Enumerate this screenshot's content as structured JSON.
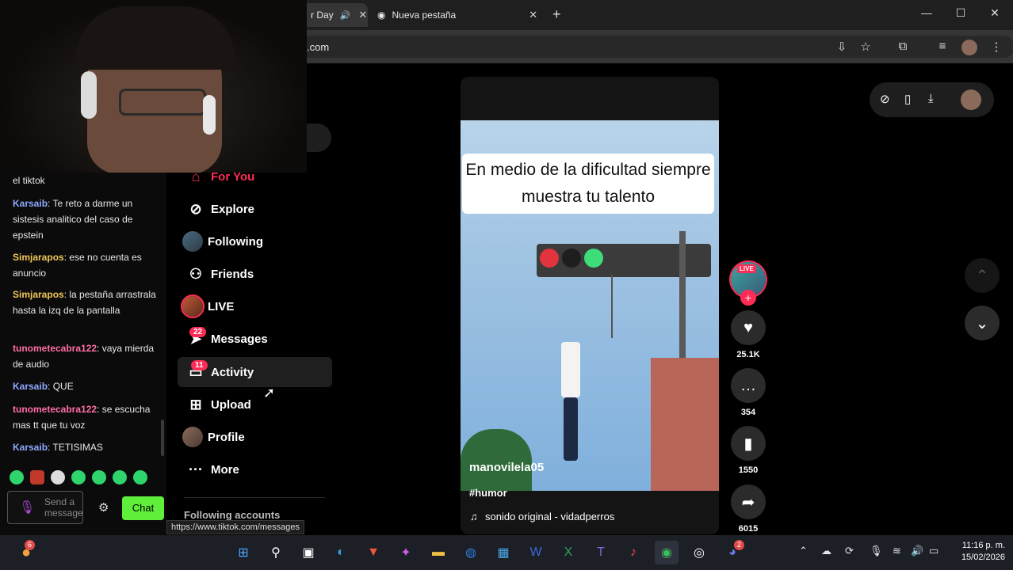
{
  "browser": {
    "tabs": [
      {
        "label": "r Day"
      },
      {
        "label": "Nueva pestaña"
      }
    ],
    "url": ".com",
    "new_tab": "+"
  },
  "sidebar": {
    "items": [
      {
        "label": "For You"
      },
      {
        "label": "Explore"
      },
      {
        "label": "Following"
      },
      {
        "label": "Friends"
      },
      {
        "label": "LIVE"
      },
      {
        "label": "Messages",
        "badge": "22"
      },
      {
        "label": "Activity",
        "badge": "11"
      },
      {
        "label": "Upload"
      },
      {
        "label": "Profile"
      },
      {
        "label": "More"
      }
    ],
    "section_title": "Following accounts"
  },
  "chat": {
    "messages": [
      {
        "user": "",
        "text": "el tiktok"
      },
      {
        "user": "Karsaib",
        "text": ": Te reto a darme un sistesis analitico del caso de epstein"
      },
      {
        "user": "Simjarapos",
        "text": ": ese no cuenta es anuncio"
      },
      {
        "user": "Simjarapos",
        "text": ": la pestaña arrastrala hasta la izq de la pantalla"
      },
      {
        "user": "tunometecabra122",
        "text": ": vaya mierda de audio"
      },
      {
        "user": "Karsaib",
        "text": ": QUE"
      },
      {
        "user": "tunometecabra122",
        "text": ": se escucha mas tt que tu voz"
      },
      {
        "user": "Karsaib",
        "text": ": TETISIMAS"
      }
    ],
    "input_placeholder": "Send a message",
    "chat_button": "Chat"
  },
  "video": {
    "caption": "En medio de la dificultad siempre muestra tu talento",
    "username": "manovilela05",
    "hashtag": "#humor",
    "sound": "sonido original - vidadperros",
    "live_badge": "LIVE",
    "likes": "25.1K",
    "comments": "354",
    "saves": "1550",
    "shares": "6015"
  },
  "status_url": "https://www.tiktok.com/messages",
  "taskbar": {
    "time": "11:16 p. m.",
    "date": "15/02/2026",
    "notification_count": "6",
    "discord_badge": "2"
  },
  "colors": {
    "accent": "#fe2c55",
    "chat_button": "#5fef3a"
  }
}
